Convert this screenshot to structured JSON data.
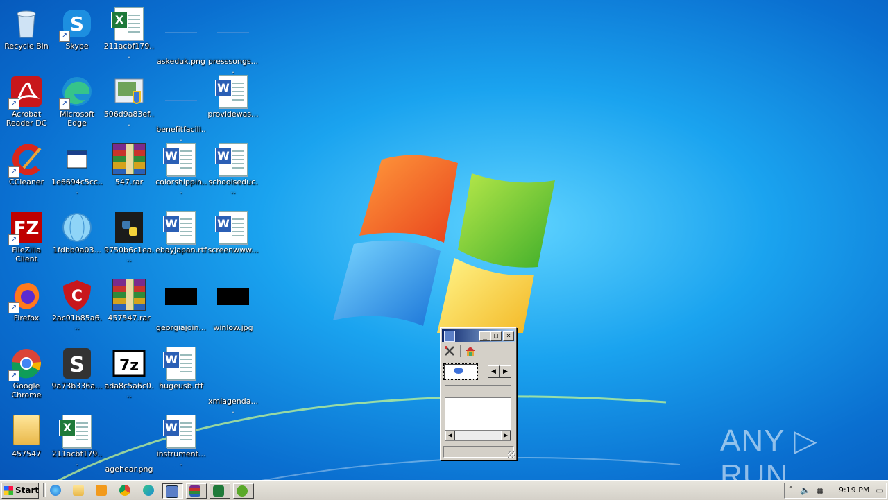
{
  "desktop_icons": [
    {
      "label": "Recycle Bin",
      "icon": "recycle-bin-icon"
    },
    {
      "label": "Skype",
      "icon": "skype-icon"
    },
    {
      "label": "211acbf179...",
      "icon": "excel-file-icon"
    },
    {
      "label": "askeduk.png",
      "icon": "image-file-icon"
    },
    {
      "label": "presssongs....",
      "icon": "image-file-icon"
    },
    {
      "label": "Acrobat Reader DC",
      "icon": "acrobat-icon"
    },
    {
      "label": "Microsoft Edge",
      "icon": "edge-icon"
    },
    {
      "label": "506d9a83ef...",
      "icon": "installer-icon"
    },
    {
      "label": "benefitfacili...",
      "icon": "image-file-icon"
    },
    {
      "label": "providewas...",
      "icon": "word-file-icon"
    },
    {
      "label": "CCleaner",
      "icon": "ccleaner-icon"
    },
    {
      "label": "1e6694c5cc...",
      "icon": "executable-icon"
    },
    {
      "label": "547.rar",
      "icon": "rar-archive-icon"
    },
    {
      "label": "colorshippin...",
      "icon": "word-file-icon"
    },
    {
      "label": "schoolseduc...",
      "icon": "word-file-icon"
    },
    {
      "label": "FileZilla Client",
      "icon": "filezilla-icon"
    },
    {
      "label": "1fdbb0a03...",
      "icon": "globe-icon"
    },
    {
      "label": "9750b6c1ea...",
      "icon": "python-file-icon"
    },
    {
      "label": "ebayjapan.rtf",
      "icon": "word-file-icon"
    },
    {
      "label": "screenwww...",
      "icon": "word-file-icon"
    },
    {
      "label": "Firefox",
      "icon": "firefox-icon"
    },
    {
      "label": "2ac01b85a6...",
      "icon": "shield-c-icon"
    },
    {
      "label": "457547.rar",
      "icon": "rar-archive-icon"
    },
    {
      "label": "georgiajoin...",
      "icon": "image-file-icon"
    },
    {
      "label": "winlow.jpg",
      "icon": "image-file-icon"
    },
    {
      "label": "Google Chrome",
      "icon": "chrome-icon"
    },
    {
      "label": "9a73b336a...",
      "icon": "s-app-icon"
    },
    {
      "label": "ada8c5a6c0...",
      "icon": "7zip-icon"
    },
    {
      "label": "hugeusb.rtf",
      "icon": "word-file-icon"
    },
    {
      "label": "xmlagenda....",
      "icon": "image-file-icon"
    },
    {
      "label": "457547",
      "icon": "folder-icon"
    },
    {
      "label": "211acbf179...",
      "icon": "excel-file-icon"
    },
    {
      "label": "agehear.png",
      "icon": "image-file-icon"
    },
    {
      "label": "instrument....",
      "icon": "word-file-icon"
    }
  ],
  "taskbar": {
    "start_label": "Start",
    "quick_launch": [
      "ie-icon",
      "explorer-icon",
      "media-player-icon",
      "chrome-icon",
      "edge-icon"
    ],
    "tasks": [
      "network-tool-icon",
      "winrar-icon",
      "excel-icon",
      "utorrent-icon"
    ],
    "tray": {
      "clock": "9:19 PM"
    }
  },
  "mini_window": {
    "title": "",
    "toolbar": [
      "tools-icon",
      "home-icon"
    ],
    "nav": {
      "prev": "◀",
      "next": "▶"
    }
  },
  "watermark": "ANY ▷ RUN"
}
